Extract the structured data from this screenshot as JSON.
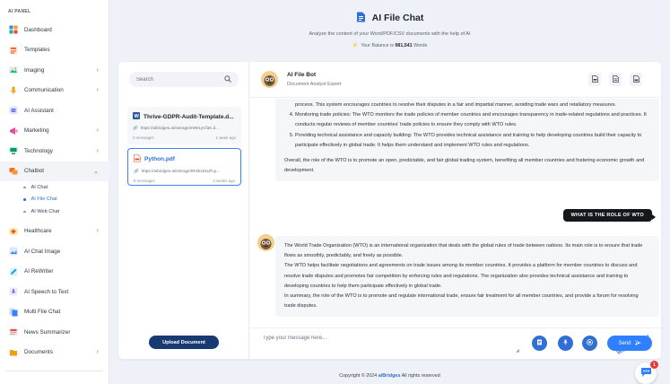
{
  "sidebar": {
    "panel_label": "AI PANEL",
    "items": [
      {
        "label": "Dashboard",
        "icon": "dashboard-icon",
        "chevron": ""
      },
      {
        "label": "Templates",
        "icon": "templates-icon",
        "chevron": ""
      },
      {
        "label": "Imaging",
        "icon": "imaging-icon",
        "chevron": "›"
      },
      {
        "label": "Communication",
        "icon": "communication-icon",
        "chevron": "›"
      },
      {
        "label": "AI Assistant",
        "icon": "assistant-icon",
        "chevron": ""
      },
      {
        "label": "Marketing",
        "icon": "marketing-icon",
        "chevron": "›"
      },
      {
        "label": "Technology",
        "icon": "technology-icon",
        "chevron": "›"
      },
      {
        "label": "Chatbot",
        "icon": "chatbot-icon",
        "chevron": "⌄"
      }
    ],
    "chatbot_sub": [
      "AI Chat",
      "AI File Chat",
      "AI Web Chat"
    ],
    "items_after": [
      {
        "label": "Healthcare",
        "icon": "healthcare-icon",
        "chevron": "›"
      },
      {
        "label": "AI Chat Image",
        "icon": "chat-image-icon",
        "chevron": ""
      },
      {
        "label": "AI ReWriter",
        "icon": "rewriter-icon",
        "chevron": ""
      },
      {
        "label": "AI Speech to Text",
        "icon": "speech-icon",
        "chevron": ""
      },
      {
        "label": "Multi File Chat",
        "icon": "multi-file-icon",
        "chevron": ""
      },
      {
        "label": "News Summarizer",
        "icon": "news-icon",
        "chevron": ""
      },
      {
        "label": "Documents",
        "icon": "documents-icon",
        "chevron": "›"
      }
    ]
  },
  "header": {
    "title": "AI File Chat",
    "subtitle": "Analyze the content of your Word/PDF/CSV documents with the help of AI",
    "balance_prefix": "Your Balance is",
    "balance_value": "981,541",
    "balance_suffix": "Words"
  },
  "files": {
    "search_placeholder": "Search",
    "items": [
      {
        "name": "Thrive-GDPR-Audit-Template.d...",
        "link": "https://aibridges.ai/storage/eWe1yCfaK.d...",
        "messages": "0 messages",
        "time": "1 week ago"
      },
      {
        "name": "Python.pdf",
        "link": "https://aibridges.ai/storage/9FZkxDUZh.p...",
        "messages": "5 messages",
        "time": "3 weeks ago"
      }
    ],
    "upload_label": "Upload Document"
  },
  "bot": {
    "name": "AI File Bot",
    "role": "Document Analyst Expert"
  },
  "messages": {
    "first_fragment": "process. This system encourages countries to resolve their disputes in a fair and impartial manner, avoiding trade wars and retaliatory measures.",
    "list_items": [
      "Monitoring trade policies: The WTO monitors the trade policies of member countries and encourages transparency in trade-related regulations and practices. It conducts regular reviews of member countries' trade policies to ensure they comply with WTO rules.",
      "Providing technical assistance and capacity building: The WTO provides technical assistance and training to help developing countries build their capacity to participate effectively in global trade. It helps them understand and implement WTO rules and regulations."
    ],
    "first_summary": "Overall, the role of the WTO is to promote an open, predictable, and fair global trading system, benefiting all member countries and fostering economic growth and development.",
    "user_question": "WHAT IS THE ROLE OF WTO",
    "answer_p1": "The World Trade Organization (WTO) is an international organization that deals with the global rules of trade between nations. Its main role is to ensure that trade flows as smoothly, predictably, and freely as possible.",
    "answer_p2": "The WTO helps facilitate negotiations and agreements on trade issues among its member countries. It provides a platform for member countries to discuss and resolve trade disputes and promotes fair competition by enforcing rules and regulations. The organization also provides technical assistance and training to developing countries to help them participate effectively in global trade.",
    "answer_p3": "In summary, the role of the WTO is to promote and regulate international trade, ensure fair treatment for all member countries, and provide a forum for resolving trade disputes."
  },
  "composer": {
    "placeholder": "Type your message here...",
    "send_label": "Send"
  },
  "footer": {
    "prefix": "Copyright © 2024",
    "brand": "aiBridges",
    "suffix": "All rights reserved"
  },
  "widget": {
    "text": "We Are Here!",
    "badge": "1"
  },
  "colors": {
    "accent": "#2f6fd6",
    "send": "#2f80ff",
    "upload": "#173a73"
  }
}
